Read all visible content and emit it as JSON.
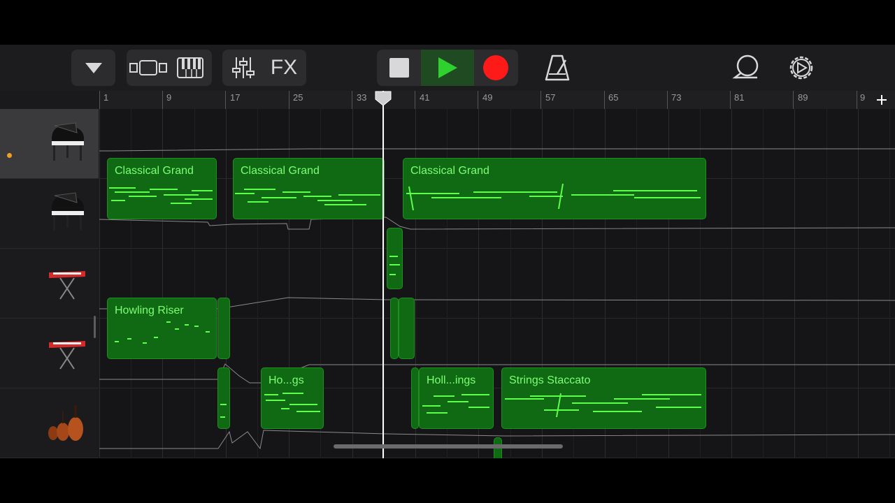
{
  "toolbar": {
    "fx_label": "FX"
  },
  "ruler": {
    "bar_numbers": [
      "1",
      "9",
      "17",
      "25",
      "33",
      "41",
      "49",
      "57",
      "65",
      "73",
      "81",
      "89",
      "9"
    ]
  },
  "tracks": [
    {
      "instrument_icon": "grand-piano-icon",
      "selected": true,
      "regions": [
        {
          "label": "Classical Grand"
        },
        {
          "label": "Classical Grand"
        },
        {
          "label": "Classical Grand"
        }
      ]
    },
    {
      "instrument_icon": "grand-piano-icon",
      "selected": false,
      "regions": [
        {
          "label": ""
        }
      ]
    },
    {
      "instrument_icon": "red-keyboard-icon",
      "selected": false,
      "regions": [
        {
          "label": "Howling Riser"
        },
        {
          "label": ""
        },
        {
          "label": ""
        },
        {
          "label": ""
        }
      ]
    },
    {
      "instrument_icon": "red-keyboard-icon",
      "selected": false,
      "regions": [
        {
          "label": ""
        },
        {
          "label": "Ho...gs"
        },
        {
          "label": ""
        },
        {
          "label": "Holl...ings"
        },
        {
          "label": "Strings Staccato"
        }
      ]
    },
    {
      "instrument_icon": "string-ensemble-icon",
      "selected": false,
      "regions": [
        {
          "label": ""
        }
      ]
    }
  ],
  "colors": {
    "region_fill": "#0f6a13",
    "region_text": "#7dff74",
    "play_green": "#2ed12e",
    "record_red": "#ff1a1a"
  }
}
